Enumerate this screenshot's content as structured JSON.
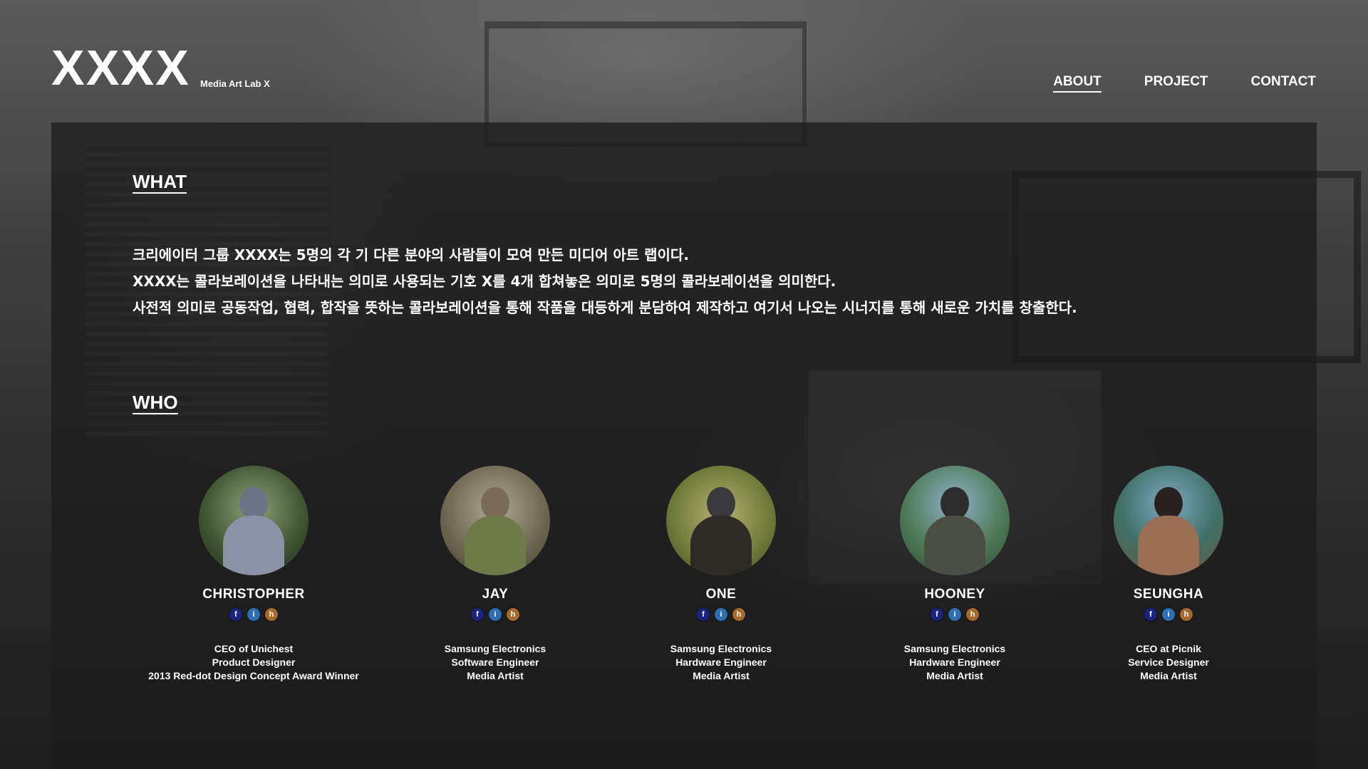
{
  "header": {
    "logo": "XXXX",
    "subtitle": "Media Art Lab X",
    "nav": [
      "ABOUT",
      "PROJECT",
      "CONTACT"
    ]
  },
  "what": {
    "title": "WHAT",
    "lines": [
      "크리에이터 그룹 XXXX는 5명의 각 기 다른 분야의 사람들이 모여 만든 미디어 아트 랩이다.",
      "XXXX는 콜라보레이션을 나타내는 의미로 사용되는 기호 X를 4개 합쳐놓은 의미로 5명의 콜라보레이션을 의미한다.",
      "사전적 의미로 공동작업, 협력, 합작을 뜻하는 콜라보레이션을 통해 작품을 대등하게 분담하여 제작하고 여기서 나오는 시너지를 통해 새로운 가치를 창출한다."
    ]
  },
  "who": {
    "title": "WHO",
    "social_icons": [
      "f",
      "i",
      "h"
    ],
    "members": [
      {
        "name": "CHRISTOPHER",
        "roles": [
          "CEO of Unichest",
          "Product Designer",
          "2013 Red-dot Design Concept Award Winner"
        ]
      },
      {
        "name": "JAY",
        "roles": [
          "Samsung Electronics",
          "Software Engineer",
          "Media Artist"
        ]
      },
      {
        "name": "ONE",
        "roles": [
          "Samsung Electronics",
          "Hardware Engineer",
          "Media Artist"
        ]
      },
      {
        "name": "HOONEY",
        "roles": [
          "Samsung Electronics",
          "Hardware Engineer",
          "Media Artist"
        ]
      },
      {
        "name": "SEUNGHA",
        "roles": [
          "CEO at Picnik",
          "Service Designer",
          "Media Artist"
        ]
      }
    ]
  },
  "colors": {
    "facebook": "#1a237e",
    "instagram": "#2d6fb2",
    "homepage": "#a66a2c"
  }
}
